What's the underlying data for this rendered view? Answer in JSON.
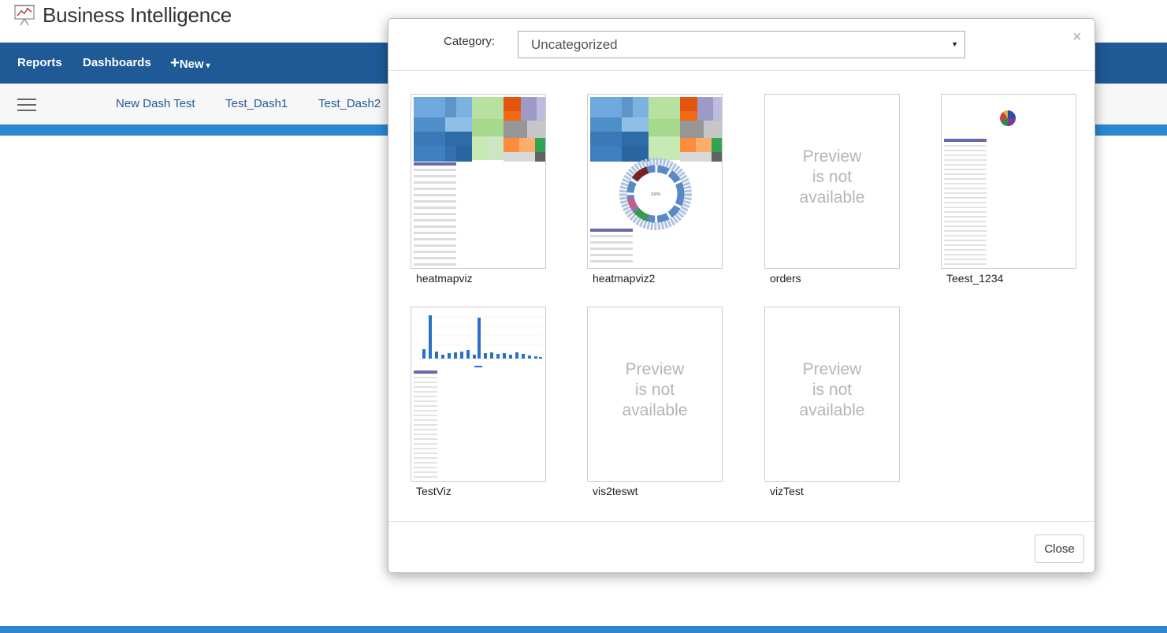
{
  "app": {
    "title": "Business Intelligence",
    "logo_icon": "presentation-chart-icon"
  },
  "nav": {
    "reports": "Reports",
    "dashboards": "Dashboards",
    "new_plus": "+",
    "new": "New",
    "new_caret": "▾"
  },
  "dashboards": [
    "New Dash Test",
    "Test_Dash1",
    "Test_Dash2"
  ],
  "modal": {
    "category_label": "Category:",
    "category_value": "Uncategorized",
    "close_x": "×",
    "close_button": "Close",
    "no_preview": [
      "Preview",
      "is not",
      "available"
    ],
    "items": [
      {
        "label": "heatmapviz",
        "preview": "treemap-table"
      },
      {
        "label": "heatmapviz2",
        "preview": "treemap-sunburst-table"
      },
      {
        "label": "orders",
        "preview": "none"
      },
      {
        "label": "Teest_1234",
        "preview": "pie-table"
      },
      {
        "label": "TestViz",
        "preview": "bar-table"
      },
      {
        "label": "vis2teswt",
        "preview": "none"
      },
      {
        "label": "vizTest",
        "preview": "none"
      }
    ]
  },
  "colors": {
    "navbar": "#1f5a96",
    "strip": "#2b87d1",
    "link": "#1f5a96",
    "bar": "#2a6fc9"
  }
}
